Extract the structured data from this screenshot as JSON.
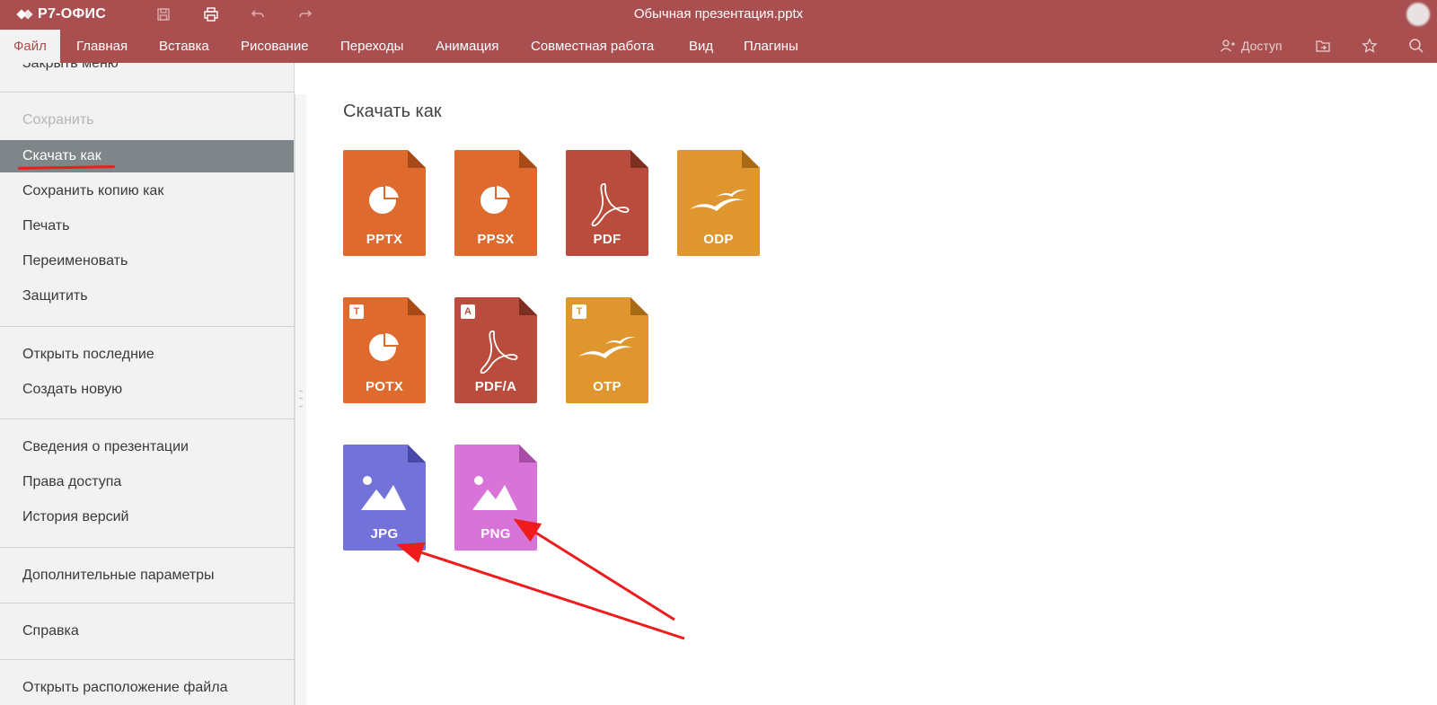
{
  "app": {
    "brand": "Р7-ОФИС",
    "document_title": "Обычная презентация.pptx",
    "accent_color": "#a94f50"
  },
  "titlebar_icons": [
    "save-icon",
    "print-icon",
    "undo-icon",
    "redo-icon"
  ],
  "menu": {
    "tabs": [
      "Файл",
      "Главная",
      "Вставка",
      "Рисование",
      "Переходы",
      "Анимация",
      "Совместная работа",
      "Вид",
      "Плагины"
    ],
    "active_tab": "Файл",
    "share_label": "Доступ",
    "right_icons": [
      "share-user-icon",
      "open-location-icon",
      "favorite-star-icon",
      "search-icon"
    ]
  },
  "file_menu": {
    "items": [
      {
        "label": "Закрыть меню"
      },
      {
        "label": "Сохранить",
        "disabled": true
      },
      {
        "label": "Скачать как",
        "selected": true
      },
      {
        "label": "Сохранить копию как"
      },
      {
        "label": "Печать"
      },
      {
        "label": "Переименовать"
      },
      {
        "label": "Защитить"
      },
      {
        "label": "Открыть последние"
      },
      {
        "label": "Создать новую"
      },
      {
        "label": "Сведения о презентации"
      },
      {
        "label": "Права доступа"
      },
      {
        "label": "История версий"
      },
      {
        "label": "Дополнительные параметры"
      },
      {
        "label": "Справка"
      },
      {
        "label": "Открыть расположение файла"
      }
    ]
  },
  "download_panel": {
    "title": "Скачать как",
    "formats": [
      {
        "label": "PPTX",
        "color": "#df6a2e",
        "icon": "presentation-pie-icon"
      },
      {
        "label": "PPSX",
        "color": "#df6a2e",
        "icon": "presentation-pie-icon"
      },
      {
        "label": "PDF",
        "color": "#b94c3d",
        "icon": "acrobat-icon"
      },
      {
        "label": "ODP",
        "color": "#e0962e",
        "icon": "gulls-icon"
      },
      {
        "label": "POTX",
        "color": "#df6a2e",
        "icon": "presentation-pie-icon",
        "badge": "T"
      },
      {
        "label": "PDF/A",
        "color": "#b94c3d",
        "icon": "acrobat-icon",
        "badge": "A"
      },
      {
        "label": "OTP",
        "color": "#e0962e",
        "icon": "gulls-icon",
        "badge": "T"
      },
      {
        "label": "JPG",
        "color": "#7272d8",
        "icon": "image-icon"
      },
      {
        "label": "PNG",
        "color": "#d874d8",
        "icon": "image-icon"
      }
    ]
  }
}
